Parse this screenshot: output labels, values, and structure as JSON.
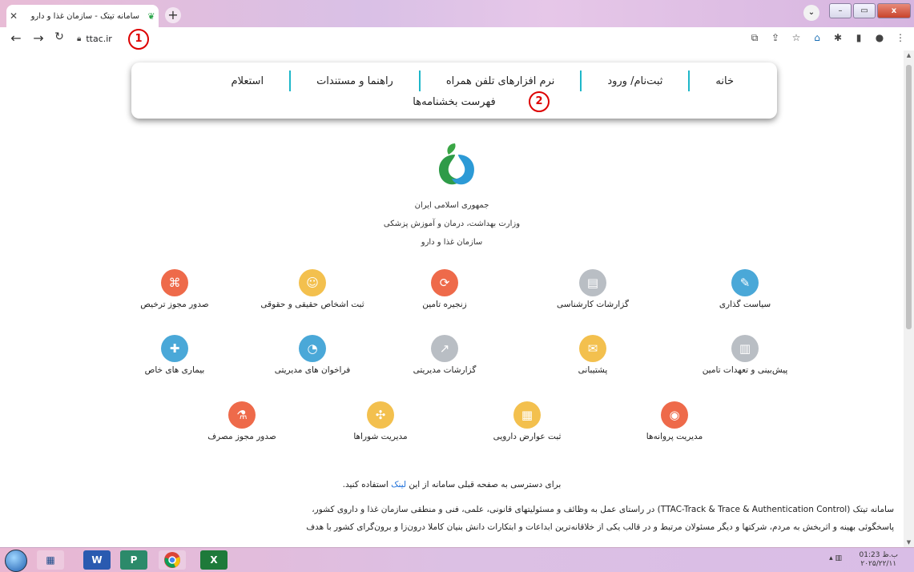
{
  "browser": {
    "tab_title": "سامانه تیتک - سازمان غذا و دارو",
    "url": "ttac.ir",
    "annotation_1": "1",
    "annotation_2": "2"
  },
  "menu": {
    "items": [
      "خانه",
      "ثبت‌نام/ ورود",
      "نرم افزارهای تلفن همراه",
      "راهنما و مستندات",
      "استعلام"
    ],
    "second_row": "فهرست بخشنامه‌ها"
  },
  "header": {
    "line1": "جمهوری اسلامی ایران",
    "line2": "وزارت بهداشت، درمان و آموزش پزشکی",
    "line3": "سازمان غذا و دارو"
  },
  "services": {
    "row1": [
      {
        "label": "سیاست گذاری",
        "icon": "policy-icon",
        "color": "#4aa8d8"
      },
      {
        "label": "گزارشات کارشناسی",
        "icon": "report-icon",
        "color": "#b9bec4"
      },
      {
        "label": "زنجیره تامین",
        "icon": "supply-chain-icon",
        "color": "#ee6a4a"
      },
      {
        "label": "ثبت اشخاص حقیقی و حقوقی",
        "icon": "people-icon",
        "color": "#f3c04e"
      },
      {
        "label": "صدور مجوز ترخیص",
        "icon": "map-icon",
        "color": "#ee6a4a"
      }
    ],
    "row2": [
      {
        "label": "پیش‌بینی و تعهدات تامین",
        "icon": "forecast-icon",
        "color": "#b9bec4"
      },
      {
        "label": "پشتیبانی",
        "icon": "support-icon",
        "color": "#f3c04e"
      },
      {
        "label": "گزارشات مدیریتی",
        "icon": "chart-icon",
        "color": "#b9bec4"
      },
      {
        "label": "فراخوان های مدیریتی",
        "icon": "recall-icon",
        "color": "#4aa8d8"
      },
      {
        "label": "بیماری های خاص",
        "icon": "medicine-icon",
        "color": "#4aa8d8"
      }
    ],
    "row3": [
      {
        "label": "مدیریت پروانه‌ها",
        "icon": "license-icon",
        "color": "#ee6a4a"
      },
      {
        "label": "ثبت عوارض دارویی",
        "icon": "side-effect-icon",
        "color": "#f3c04e"
      },
      {
        "label": "مدیریت شوراها",
        "icon": "council-icon",
        "color": "#f3c04e"
      },
      {
        "label": "صدور مجوز مصرف",
        "icon": "consumption-icon",
        "color": "#ee6a4a"
      }
    ]
  },
  "access": {
    "before": "برای دسترسی به صفحه قبلی سامانه از این ",
    "link": "لینک",
    "after": " استفاده کنید."
  },
  "description": {
    "line1": "سامانه تیتک (TTAC-Track & Trace & Authentication Control) در راستای عمل به وظائف و مسئولیتهای قانونی، علمی، فنی و منطقی سازمان غذا و داروی کشور،",
    "line2": "پاسخگوئی بهینه و اثربخش به مردم، شرکتها و دیگر مسئولان مرتبط و در قالب یکی از خلاقانه‌ترین ابداعات و ابتکارات دانش بنیان کاملا درون‌زا و برون‌گرای کشور با هدف"
  },
  "taskbar": {
    "time": "01:23 ب.ظ",
    "date": "۲۰۲۵/۲۲/۱۱",
    "apps": [
      "W",
      "P",
      "",
      "X"
    ]
  }
}
